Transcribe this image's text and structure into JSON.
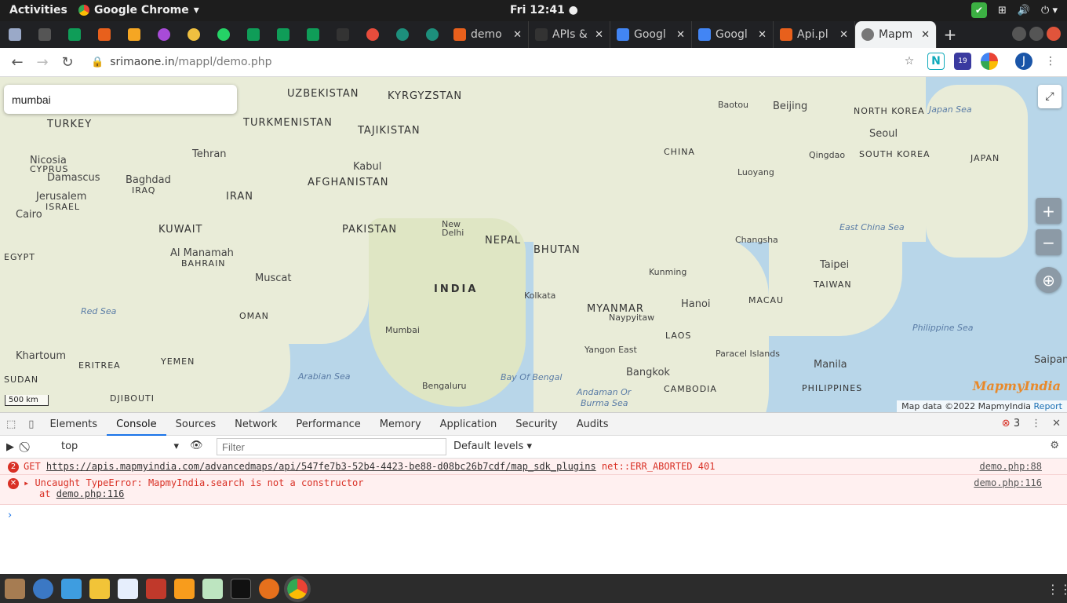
{
  "os": {
    "activities": "Activities",
    "app_name": "Google Chrome",
    "clock": "Fri 12:41"
  },
  "tabs": [
    {
      "title": "demo",
      "favicon_color": "#e8601c"
    },
    {
      "title": "APIs &",
      "favicon_color": "#333333"
    },
    {
      "title": "Googl",
      "favicon_color": "#4285f4"
    },
    {
      "title": "Googl",
      "favicon_color": "#4285f4"
    },
    {
      "title": "Api.pl",
      "favicon_color": "#e8601c"
    },
    {
      "title": "Mapm",
      "favicon_color": "#555555"
    }
  ],
  "address": {
    "host": "srimaone.in",
    "path": "/mappl/demo.php"
  },
  "extensions": {
    "badge": "19",
    "profile_initial": "J"
  },
  "map": {
    "search_value": "mumbai",
    "labels": [
      {
        "text": "UZBEKISTAN",
        "cls": "big"
      },
      {
        "text": "KYRGYZSTAN",
        "cls": "big"
      },
      {
        "text": "TURKEY",
        "cls": "big"
      },
      {
        "text": "TURKMENISTAN",
        "cls": "big"
      },
      {
        "text": "TAJIKISTAN",
        "cls": "big"
      },
      {
        "text": "Tehran",
        "cls": ""
      },
      {
        "text": "Nicosia",
        "cls": ""
      },
      {
        "text": "CYPRUS",
        "cls": "big"
      },
      {
        "text": "Damascus",
        "cls": ""
      },
      {
        "text": "Kabul",
        "cls": ""
      },
      {
        "text": "AFGHANISTAN",
        "cls": "big"
      },
      {
        "text": "Baghdad",
        "cls": ""
      },
      {
        "text": "IRAQ",
        "cls": "big"
      },
      {
        "text": "Jerusalem",
        "cls": ""
      },
      {
        "text": "ISRAEL",
        "cls": "big"
      },
      {
        "text": "IRAN",
        "cls": "big"
      },
      {
        "text": "Cairo",
        "cls": ""
      },
      {
        "text": "KUWAIT",
        "cls": "big"
      },
      {
        "text": "PAKISTAN",
        "cls": "big"
      },
      {
        "text": "New Delhi",
        "cls": ""
      },
      {
        "text": "NEPAL",
        "cls": "big"
      },
      {
        "text": "BHUTAN",
        "cls": "big"
      },
      {
        "text": "EGYPT",
        "cls": "big"
      },
      {
        "text": "Al Manamah",
        "cls": ""
      },
      {
        "text": "BAHRAIN",
        "cls": "big"
      },
      {
        "text": "Muscat",
        "cls": ""
      },
      {
        "text": "INDIA",
        "cls": "big"
      },
      {
        "text": "Kolkata",
        "cls": ""
      },
      {
        "text": "MYANMAR",
        "cls": "big"
      },
      {
        "text": "Naypyitaw",
        "cls": ""
      },
      {
        "text": "Red Sea",
        "cls": "sea"
      },
      {
        "text": "OMAN",
        "cls": "big"
      },
      {
        "text": "Mumbai",
        "cls": ""
      },
      {
        "text": "Yangon East",
        "cls": ""
      },
      {
        "text": "Khartoum",
        "cls": ""
      },
      {
        "text": "ERITREA",
        "cls": "big"
      },
      {
        "text": "YEMEN",
        "cls": "big"
      },
      {
        "text": "Arabian Sea",
        "cls": "sea"
      },
      {
        "text": "Bay Of Bengal",
        "cls": "sea"
      },
      {
        "text": "Bangkok",
        "cls": ""
      },
      {
        "text": "SUDAN",
        "cls": "big"
      },
      {
        "text": "DJIBOUTI",
        "cls": "big"
      },
      {
        "text": "Bengaluru",
        "cls": ""
      },
      {
        "text": "Andaman Or",
        "cls": "sea"
      },
      {
        "text": "Burma Sea",
        "cls": "sea"
      },
      {
        "text": "CAMBODIA",
        "cls": "big"
      },
      {
        "text": "Baotou",
        "cls": ""
      },
      {
        "text": "Beijing",
        "cls": ""
      },
      {
        "text": "NORTH KOREA",
        "cls": "big"
      },
      {
        "text": "Japan Sea",
        "cls": "sea"
      },
      {
        "text": "CHINA",
        "cls": "big"
      },
      {
        "text": "Seoul",
        "cls": ""
      },
      {
        "text": "Qingdao",
        "cls": ""
      },
      {
        "text": "SOUTH KOREA",
        "cls": "big"
      },
      {
        "text": "JAPAN",
        "cls": "big"
      },
      {
        "text": "Luoyang",
        "cls": ""
      },
      {
        "text": "East China Sea",
        "cls": "sea"
      },
      {
        "text": "Changsha",
        "cls": ""
      },
      {
        "text": "Taipei",
        "cls": ""
      },
      {
        "text": "Kunming",
        "cls": ""
      },
      {
        "text": "TAIWAN",
        "cls": "big"
      },
      {
        "text": "Hanoi",
        "cls": ""
      },
      {
        "text": "MACAU",
        "cls": "big"
      },
      {
        "text": "Philippine Sea",
        "cls": "sea"
      },
      {
        "text": "LAOS",
        "cls": "big"
      },
      {
        "text": "Paracel Islands",
        "cls": ""
      },
      {
        "text": "Manila",
        "cls": ""
      },
      {
        "text": "Saipan",
        "cls": ""
      },
      {
        "text": "PHILIPPINES",
        "cls": "big"
      }
    ],
    "scale": "500 km",
    "brand": "MapmyIndia",
    "attribution": "Map data ©2022 MapmyIndia",
    "report": "Report"
  },
  "devtools": {
    "tabs": [
      "Elements",
      "Console",
      "Sources",
      "Network",
      "Performance",
      "Memory",
      "Application",
      "Security",
      "Audits"
    ],
    "active_tab": "Console",
    "error_count": "3",
    "context": "top",
    "filter_placeholder": "Filter",
    "levels": "Default levels",
    "messages": [
      {
        "count": "2",
        "text": "GET ",
        "url": "https://apis.mapmyindia.com/advancedmaps/api/547fe7b3-52b4-4423-be88-d08bc26b7cdf/map_sdk_plugins",
        "suffix": " net::ERR_ABORTED 401",
        "source": "demo.php:88"
      },
      {
        "count": "",
        "text": "Uncaught TypeError: MapmyIndia.search is not a constructor",
        "url": "",
        "suffix": "",
        "at": "at ",
        "at_link": "demo.php:116",
        "source": "demo.php:116"
      }
    ]
  }
}
